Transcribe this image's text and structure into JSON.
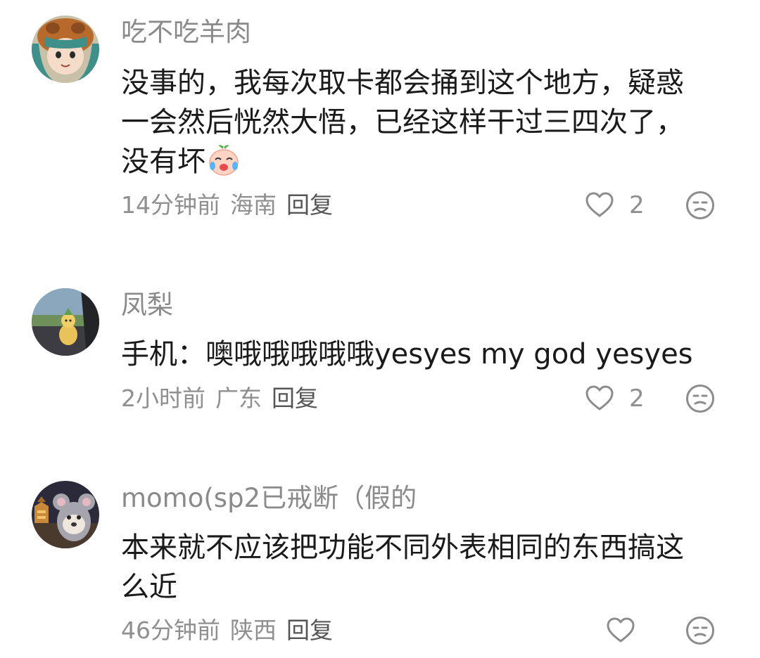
{
  "comments": [
    {
      "username": "吃不吃羊肉",
      "text_lines": [
        "没事的，我每次取卡都会捅到这个地方，疑惑",
        "一会然后恍然大悟，已经这样干过三四次了，",
        "没有坏"
      ],
      "emoji": "crying-laughing-peach-emoji",
      "time": "14分钟前",
      "location": "海南",
      "reply_label": "回复",
      "likes": "2",
      "avatar": "anime-character-avatar"
    },
    {
      "username": "凤梨",
      "text_lines": [
        "手机：噢哦哦哦哦哦yesyes my god yesyes"
      ],
      "time": "2小时前",
      "location": "广东",
      "reply_label": "回复",
      "likes": "2",
      "avatar": "pineapple-toy-avatar"
    },
    {
      "username": "momo(sp2已戒断（假的",
      "text_lines": [
        "本来就不应该把功能不同外表相同的东西搞这",
        "么近"
      ],
      "time": "46分钟前",
      "location": "陕西",
      "reply_label": "回复",
      "likes": "",
      "avatar": "cartoon-mouse-avatar"
    }
  ],
  "colors": {
    "username": "#8a8a8a",
    "text": "#1a1a1a",
    "meta": "#8f8f8f",
    "icon": "#8c8c8c"
  }
}
